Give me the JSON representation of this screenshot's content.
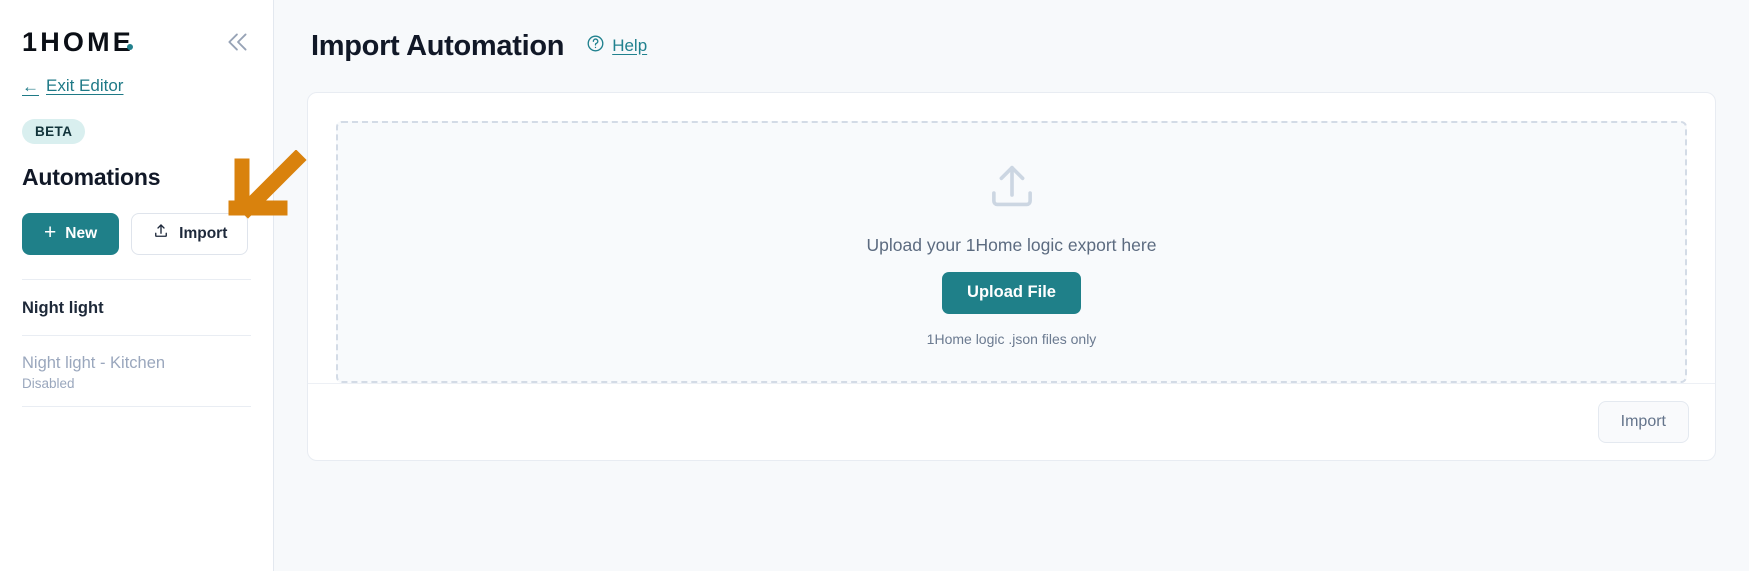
{
  "brand": {
    "logo_text": "1HOME",
    "collapse_icon": "chevron-double-left-icon"
  },
  "sidebar": {
    "exit_editor_label": "Exit Editor",
    "exit_arrow": "←",
    "beta_badge": "BETA",
    "section_title": "Automations",
    "new_button_label": "New",
    "new_button_icon": "plus-icon",
    "import_button_label": "Import",
    "import_button_icon": "upload-icon",
    "groups": [
      {
        "title": "Night light",
        "items": [
          {
            "name": "Night light - Kitchen",
            "status": "Disabled"
          }
        ]
      }
    ]
  },
  "annotation": {
    "arrow": "down-left-arrow",
    "color": "#d9820d"
  },
  "main": {
    "page_title": "Import Automation",
    "help_label": "Help",
    "help_icon": "question-circle-icon",
    "dropzone": {
      "icon": "upload-icon",
      "text": "Upload your 1Home logic export here",
      "upload_button_label": "Upload File",
      "hint": "1Home logic .json files only"
    },
    "footer": {
      "import_button_label": "Import"
    }
  },
  "colors": {
    "accent_teal": "#1f8089",
    "link_teal": "#20818e",
    "beta_bg": "#d9efef",
    "annotation_orange": "#d9820d",
    "page_bg": "#f7f9fb",
    "muted_text": "#9aa7bd"
  }
}
